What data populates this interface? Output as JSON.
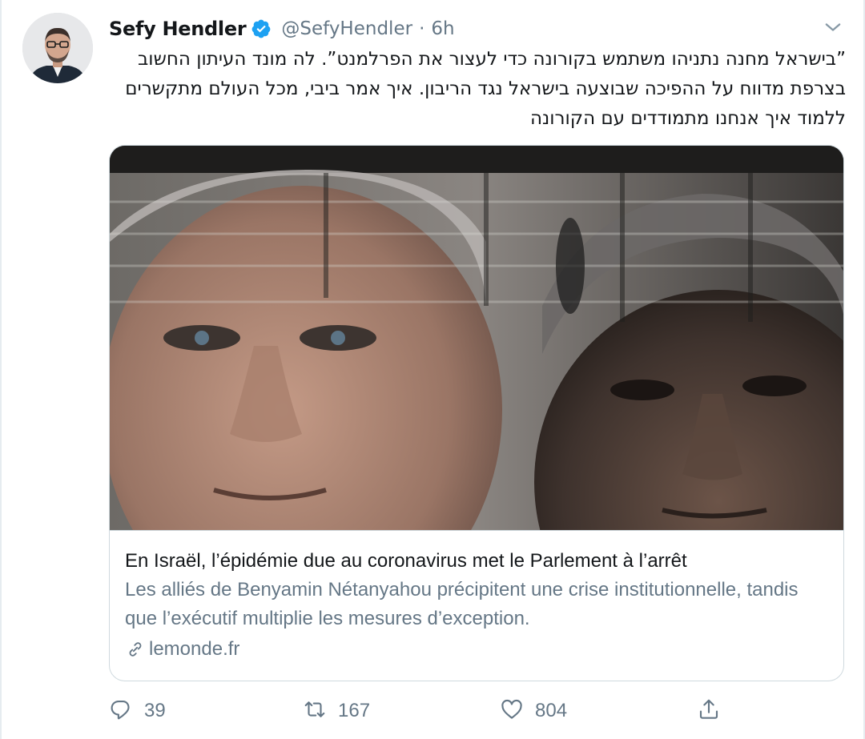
{
  "tweet": {
    "author_name": "Sefy Hendler",
    "handle": "@SefyHendler",
    "separator": "·",
    "time": "6h",
    "text": "”בישראל מחנה נתניהו משתמש בקורונה כדי לעצור את הפרלמנט”. לה מונד העיתון החשוב בצרפת מדווח על ההפיכה שבוצעה בישראל נגד הריבון. איך אמר ביבי, מכל העולם מתקשרים ללמוד איך אנחנו מתמודדים עם הקורונה"
  },
  "card": {
    "title": "En Israël, l’épidémie due au coronavirus met le Parlement à l’arrêt",
    "description": "Les alliés de Benyamin Nétanyahou précipitent une crise institutionnelle, tandis que l’exécutif multiplie les mesures d’exception.",
    "domain": "lemonde.fr"
  },
  "actions": {
    "replies": "39",
    "retweets": "167",
    "likes": "804"
  },
  "icons": {
    "verified": "verified-badge-icon",
    "caret": "chevron-down-icon",
    "link": "link-icon",
    "reply": "reply-icon",
    "retweet": "retweet-icon",
    "like": "heart-icon",
    "share": "share-icon"
  },
  "colors": {
    "verified_blue": "#1da1f2",
    "secondary_text": "#657786",
    "primary_text": "#14171a",
    "border": "#cfd9de"
  }
}
